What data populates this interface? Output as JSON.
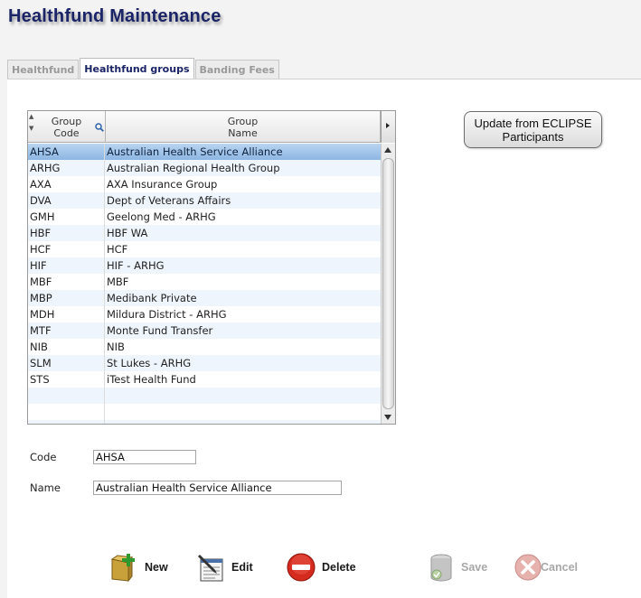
{
  "page_title": "Healthfund Maintenance",
  "tabs": [
    {
      "label": "Healthfund",
      "active": false
    },
    {
      "label": "Healthfund groups",
      "active": true
    },
    {
      "label": "Banding Fees",
      "active": false
    }
  ],
  "grid": {
    "columns": [
      {
        "line1": "Group",
        "line2": "Code"
      },
      {
        "line1": "Group",
        "line2": "Name"
      }
    ],
    "selected_index": 0,
    "rows": [
      {
        "code": "AHSA",
        "name": "Australian Health Service Alliance"
      },
      {
        "code": "ARHG",
        "name": "Australian Regional Health Group"
      },
      {
        "code": "AXA",
        "name": "AXA Insurance Group"
      },
      {
        "code": "DVA",
        "name": "Dept of Veterans Affairs"
      },
      {
        "code": "GMH",
        "name": "Geelong Med - ARHG"
      },
      {
        "code": "HBF",
        "name": "HBF WA"
      },
      {
        "code": "HCF",
        "name": "HCF"
      },
      {
        "code": "HIF",
        "name": "HIF - ARHG"
      },
      {
        "code": "MBF",
        "name": "MBF"
      },
      {
        "code": "MBP",
        "name": "Medibank Private"
      },
      {
        "code": "MDH",
        "name": "Mildura District - ARHG"
      },
      {
        "code": "MTF",
        "name": "Monte Fund Transfer"
      },
      {
        "code": "NIB",
        "name": "NIB"
      },
      {
        "code": "SLM",
        "name": "St Lukes - ARHG"
      },
      {
        "code": "STS",
        "name": "iTest Health Fund"
      }
    ]
  },
  "update_button": {
    "line1": "Update from ECLIPSE",
    "line2": "Participants"
  },
  "form": {
    "code_label": "Code",
    "code_value": "AHSA",
    "name_label": "Name",
    "name_value": "Australian Health Service Alliance"
  },
  "actions": {
    "new_label": "New",
    "edit_label": "Edit",
    "delete_label": "Delete",
    "save_label": "Save",
    "cancel_label": "Cancel"
  },
  "colors": {
    "title": "#1a2466",
    "selected_row": "#a6c6ea",
    "alt_row": "#eef5fc"
  }
}
